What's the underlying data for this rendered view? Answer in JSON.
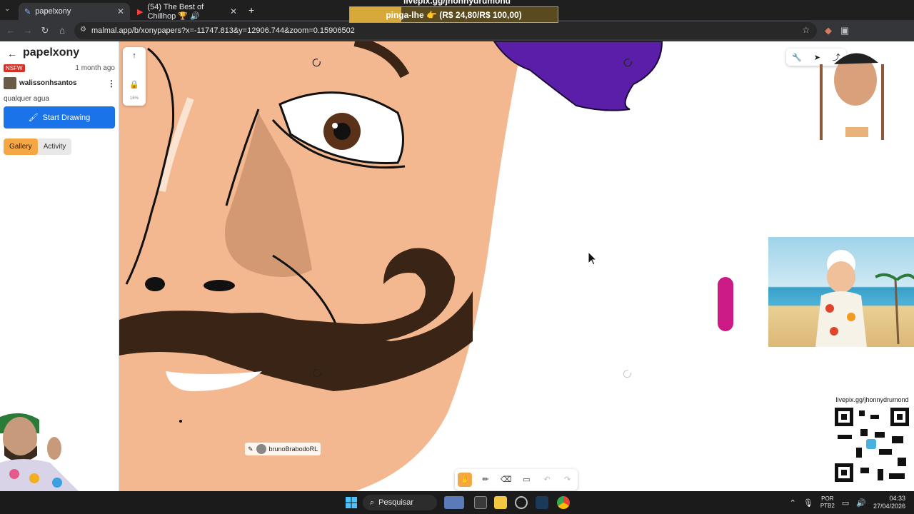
{
  "browser": {
    "tabs": [
      {
        "label": "papelxony",
        "active": true
      },
      {
        "label": "(54) The Best of Chillhop 🏆 🔊",
        "active": false
      }
    ],
    "new_tab": "+",
    "url": "malmal.app/b/xonypapers?x=-11747.813&y=12906.744&zoom=0.15906502"
  },
  "donation": {
    "top_text": "livepix.gg/jhonnydrumond",
    "text": "pinga-lhe 👉 (R$ 24,80/R$ 100,00)",
    "progress": 0.248
  },
  "sidebar": {
    "title": "papelxony",
    "badge": "NSFW",
    "age": "1 month ago",
    "username": "walissonhsantos",
    "description": "qualquer agua",
    "start_button": "Start Drawing",
    "tabs": [
      "Gallery",
      "Activity"
    ]
  },
  "canvas": {
    "credit_user": "brunoBrabodoRL",
    "zoom_label": "16%"
  },
  "overlay": {
    "qr_label": "livepix.gg/jhonnydrumond"
  },
  "taskbar": {
    "search_label": "Pesquisar",
    "lang_line1": "POR",
    "lang_line2": "PTB2",
    "time": "04:33",
    "date": "27/04/2026"
  },
  "colors": {
    "accent_orange": "#f4a742",
    "primary_blue": "#1a73e8",
    "skin": "#f3b890",
    "mustache": "#3a2416",
    "magenta": "#cc1a86",
    "purple": "#5a1ea8"
  }
}
